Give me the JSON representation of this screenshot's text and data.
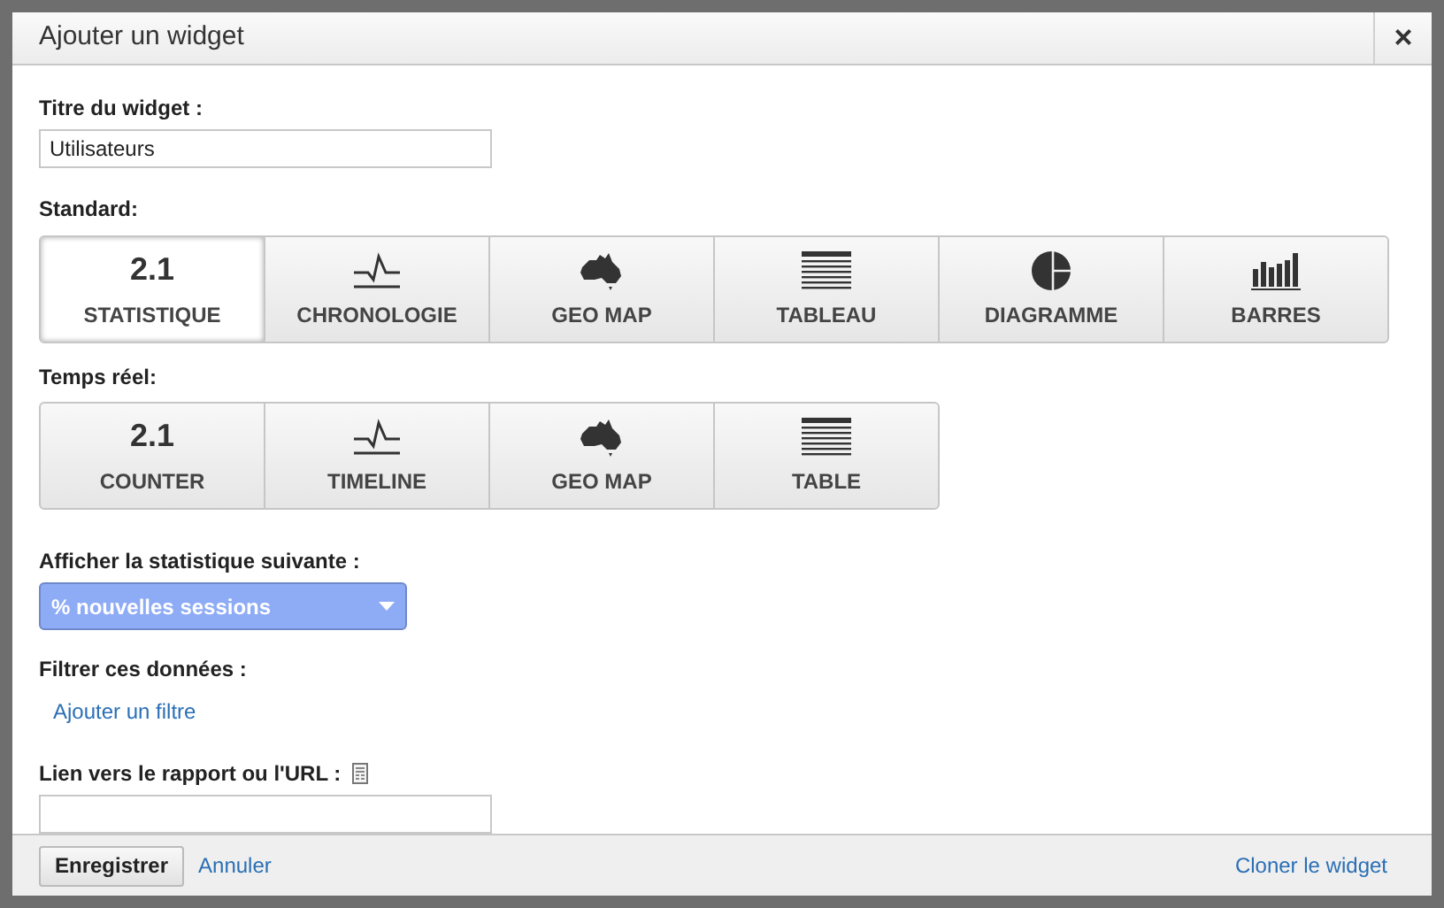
{
  "dialog": {
    "title": "Ajouter un widget",
    "close": "×"
  },
  "widget_title": {
    "label": "Titre du widget :",
    "value": "Utilisateurs"
  },
  "standard": {
    "label": "Standard:",
    "tiles": [
      {
        "kind": "number",
        "number": "2.1",
        "label": "STATISTIQUE",
        "selected": true
      },
      {
        "kind": "timeline",
        "label": "CHRONOLOGIE",
        "selected": false
      },
      {
        "kind": "map",
        "label": "GEO MAP",
        "selected": false
      },
      {
        "kind": "table",
        "label": "TABLEAU",
        "selected": false
      },
      {
        "kind": "pie",
        "label": "DIAGRAMME",
        "selected": false
      },
      {
        "kind": "bars",
        "label": "BARRES",
        "selected": false
      }
    ]
  },
  "realtime": {
    "label": "Temps réel:",
    "tiles": [
      {
        "kind": "number",
        "number": "2.1",
        "label": "COUNTER",
        "selected": false
      },
      {
        "kind": "timeline",
        "label": "TIMELINE",
        "selected": false
      },
      {
        "kind": "map",
        "label": "GEO MAP",
        "selected": false
      },
      {
        "kind": "table",
        "label": "TABLE",
        "selected": false
      }
    ]
  },
  "metric": {
    "label": "Afficher la statistique suivante :",
    "value": "% nouvelles sessions"
  },
  "filter": {
    "label": "Filtrer ces données :",
    "link": "Ajouter un filtre"
  },
  "link_field": {
    "label": "Lien vers le rapport ou l'URL :"
  },
  "footer": {
    "save": "Enregistrer",
    "cancel": "Annuler",
    "clone": "Cloner le widget"
  }
}
